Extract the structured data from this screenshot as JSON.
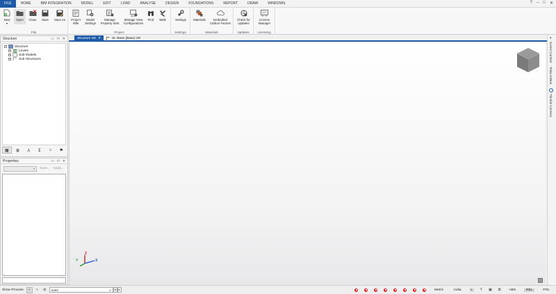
{
  "menu": {
    "file": "FILE",
    "items": [
      "HOME",
      "BIM INTEGRATION",
      "MODEL",
      "EDIT",
      "LOAD",
      "ANALYSE",
      "DESIGN",
      "FOUNDATIONS",
      "REPORT",
      "DRAW",
      "WINDOWS"
    ],
    "help": "?",
    "minimize": "–",
    "restore": "□",
    "close": "✕"
  },
  "ribbon": {
    "groups": {
      "file": "File",
      "project": "Project",
      "settings": "Settings",
      "materials": "Materials",
      "updates": "Updates",
      "licensing": "Licensing"
    },
    "buttons": {
      "new": "New",
      "open": "Open",
      "close": "Close",
      "save": "Save",
      "save_as": "Save As",
      "project_wiki_1": "Project",
      "project_wiki_2": "Wiki",
      "model_settings_1": "Model",
      "model_settings_2": "Settings",
      "manage_property_sets_1": "Manage",
      "manage_property_sets_2": "Property Sets",
      "manage_view_configs_1": "Manage View",
      "manage_view_configs_2": "Configurations",
      "find": "Find",
      "walk": "Walk",
      "settings": "Settings",
      "materials": "Materials",
      "embodied_carbon_1": "Embodied",
      "embodied_carbon_2": "Carbon Factors",
      "check_updates_1": "Check for",
      "check_updates_2": "Updates",
      "license_manager_1": "License",
      "license_manager_2": "Manager"
    }
  },
  "structure_panel": {
    "title": "Structure",
    "tree": {
      "root": "Structure",
      "children": [
        "Levels",
        "Sub Models",
        "Sub Structures"
      ]
    }
  },
  "properties_panel": {
    "title": "Properties",
    "save": "Save...",
    "apply": "Apply..."
  },
  "doc_tabs": {
    "active": "Structure 3D",
    "close": "✕",
    "second": "St. Base (Base) 2D"
  },
  "right_tabs": [
    "Scene Content",
    "Tekla Online",
    "Trimble Connect"
  ],
  "axis": {
    "x": "X",
    "y": "Y",
    "z": "Z"
  },
  "status": {
    "show_process": "Show Process",
    "input_value": "none",
    "units": "Metric",
    "region": "India",
    "abs": "ABS",
    "rel": "REL",
    "pol": "POL"
  },
  "colors": {
    "accent": "#1e5aa8",
    "stop_red": "#d22222"
  }
}
